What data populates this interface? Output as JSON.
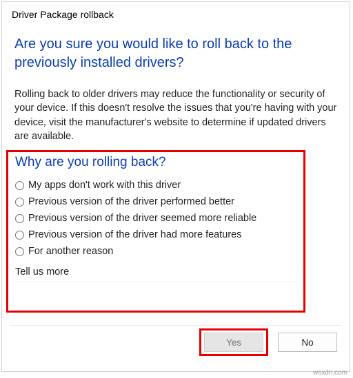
{
  "title": "Driver Package rollback",
  "heading": "Are you sure you would like to roll back to the previously installed drivers?",
  "body": "Rolling back to older drivers may reduce the functionality or security of your device. If this doesn't resolve the issues that you're having with your device, visit the manufacturer's website to determine if updated drivers are available.",
  "section": {
    "heading": "Why are you rolling back?",
    "options": [
      "My apps don't work with this driver",
      "Previous version of the driver performed better",
      "Previous version of the driver seemed more reliable",
      "Previous version of the driver had more features",
      "For another reason"
    ],
    "tell_us_more": "Tell us more"
  },
  "buttons": {
    "yes": "Yes",
    "no": "No"
  },
  "watermark": "wsxdn.com"
}
